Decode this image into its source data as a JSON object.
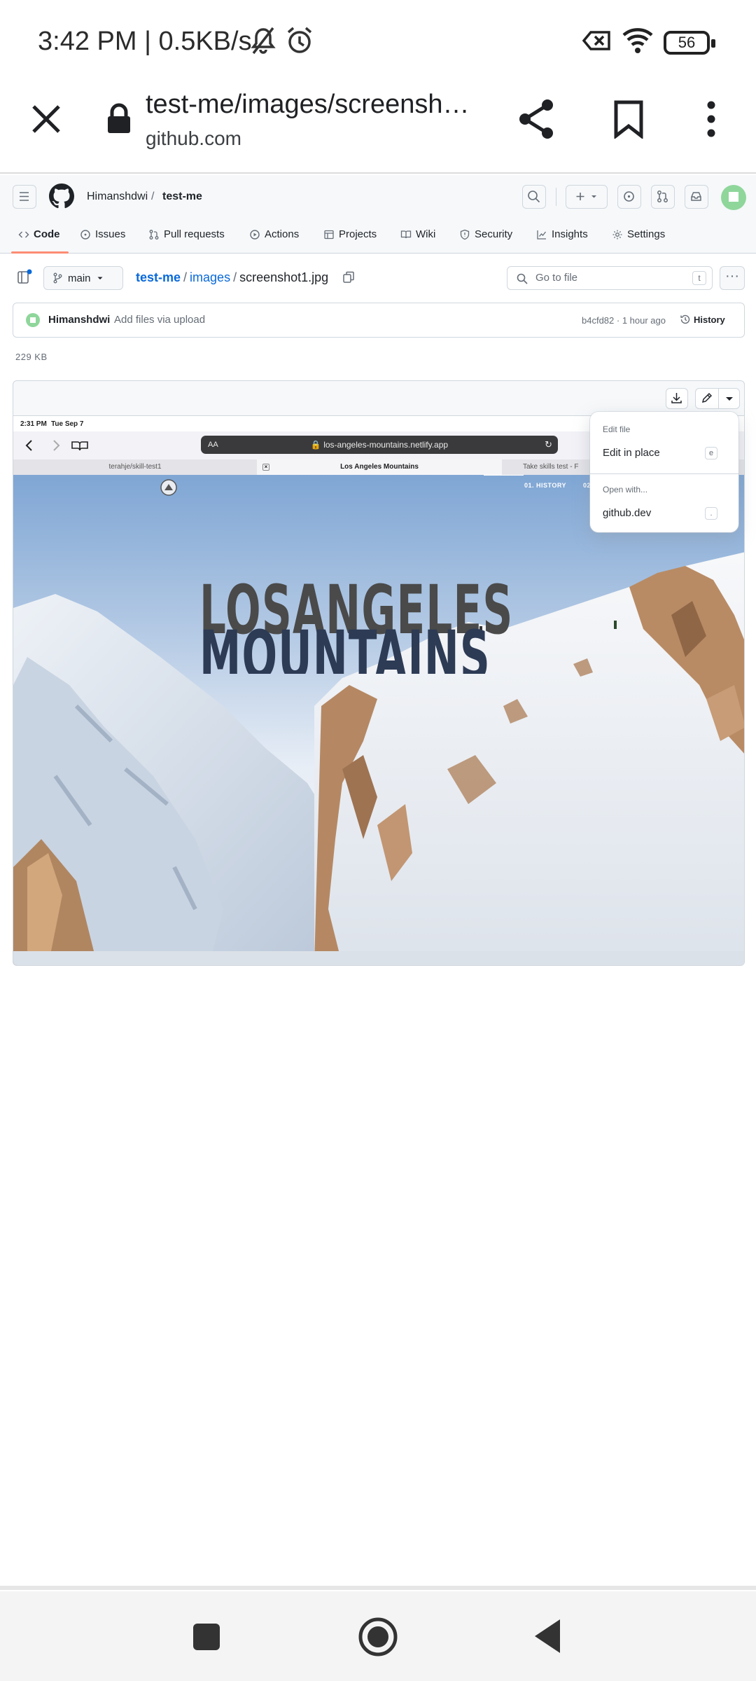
{
  "status_bar": {
    "time_speed": "3:42 PM | 0.5KB/s",
    "battery": "56",
    "icons": [
      "bell-off-icon",
      "alarm-icon",
      "no-sim-icon",
      "wifi-icon",
      "battery-icon"
    ]
  },
  "browser": {
    "page_title": "test-me/images/screensho…",
    "domain": "github.com",
    "icons": [
      "close-icon",
      "lock-icon",
      "share-icon",
      "bookmark-icon",
      "more-vert-icon"
    ]
  },
  "github": {
    "owner": "Himanshdwi",
    "slash": "/",
    "repo": "test-me",
    "nav": {
      "code": "Code",
      "issues": "Issues",
      "pull_requests": "Pull requests",
      "actions": "Actions",
      "projects": "Projects",
      "wiki": "Wiki",
      "security": "Security",
      "insights": "Insights",
      "settings": "Settings"
    },
    "branch": "main",
    "path": {
      "repo": "test-me",
      "dir": "images",
      "file": "screenshot1.jpg",
      "sep": "/"
    },
    "goto_file": {
      "placeholder": "Go to file",
      "shortcut": "t"
    },
    "commit": {
      "author": "Himanshdwi",
      "message": "Add files via upload",
      "meta": "b4cfd82 · 1 hour ago",
      "history": "History"
    },
    "file_size": "229 KB",
    "menu": {
      "edit_group": "Edit file",
      "edit_in_place": "Edit in place",
      "edit_key": "e",
      "open_group": "Open with...",
      "github_dev": "github.dev",
      "dev_key": "."
    }
  },
  "screenshot": {
    "ipad_time": "2:31 PM",
    "ipad_date": "Tue Sep 7",
    "aa": "AA",
    "url": "los-angeles-mountains.netlify.app",
    "tabs": [
      "terahje/skill-test1",
      "Los Angeles Mountains",
      "Take skills test - F"
    ],
    "hero_line1": "LOSANGELES",
    "hero_line2": "MOUNTAINS",
    "nav_history": "01. HISTORY",
    "nav_next": "02"
  },
  "colors": {
    "link": "#0969da",
    "tab_underline": "#fd8c73",
    "border": "#d0d7de",
    "muted": "#656d76"
  }
}
